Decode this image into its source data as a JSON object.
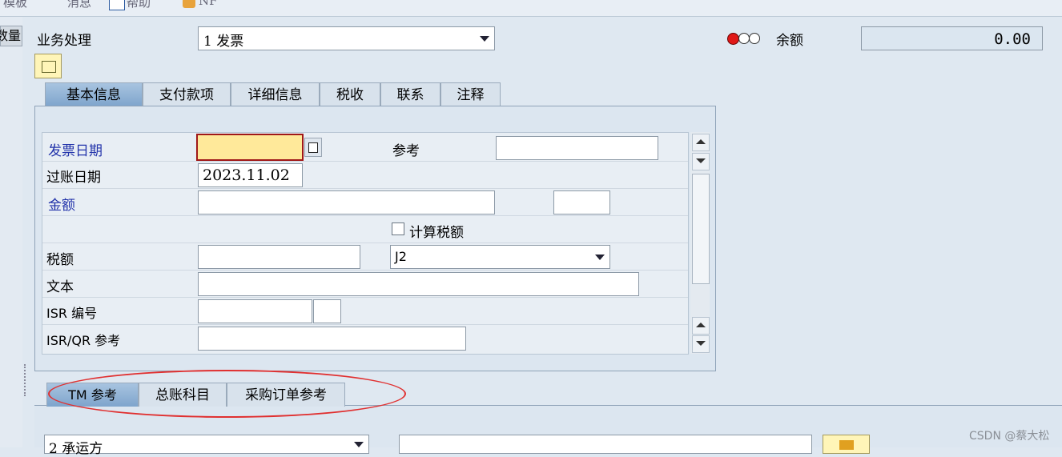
{
  "toolbar": {
    "item1": "模板",
    "item2": "消息",
    "item3": "帮助",
    "item4": "NF"
  },
  "left_tab": {
    "label": "数量"
  },
  "business": {
    "label": "业务处理",
    "value": "1 发票"
  },
  "balance": {
    "label": "余额",
    "value": "0.00"
  },
  "tabs": [
    "基本信息",
    "支付款项",
    "详细信息",
    "税收",
    "联系",
    "注释"
  ],
  "form": {
    "invoice_date_label": "发票日期",
    "invoice_date_value": "",
    "reference_label": "参考",
    "reference_value": "",
    "posting_date_label": "过账日期",
    "posting_date_value": "2023.11.02",
    "amount_label": "金额",
    "amount_value": "",
    "currency_value": "",
    "calc_tax_label": "计算税额",
    "tax_label": "税额",
    "tax_value": "",
    "tax_code_value": "J2",
    "text_label": "文本",
    "text_value": "",
    "isr_label": "ISR 编号",
    "isr_qr_label": "ISR/QR 参考"
  },
  "bottom_tabs": [
    "TM 参考",
    "总账科目",
    "采购订单参考"
  ],
  "bottom": {
    "select_value": "2 承运方"
  },
  "watermark": "CSDN @蔡大松",
  "colors": {
    "highlight_oval": "#e03030",
    "required_field": "#ffe99a",
    "active_tab": "#8fb0d4"
  }
}
